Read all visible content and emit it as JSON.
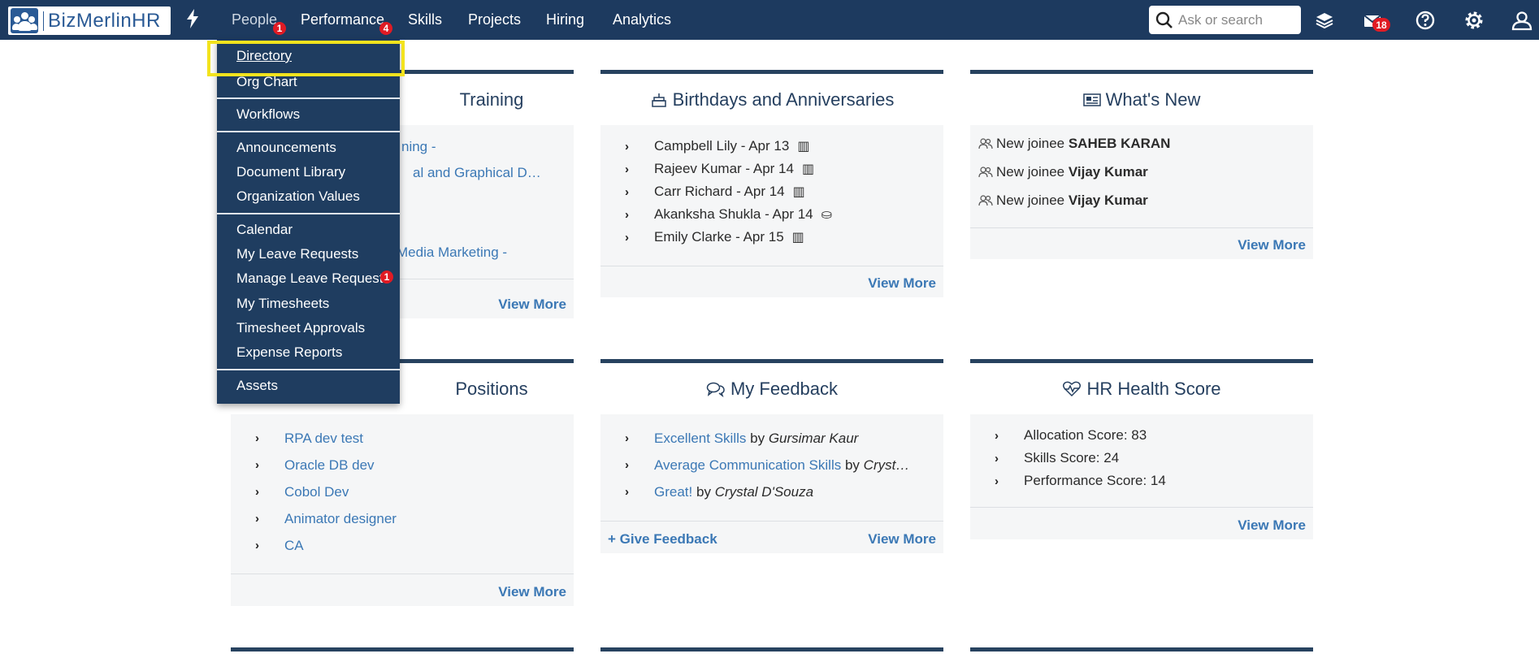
{
  "brand": {
    "name": "BizMerlinHR"
  },
  "nav": {
    "items": [
      {
        "label": "People",
        "badge": "1"
      },
      {
        "label": "Performance",
        "badge": "4"
      },
      {
        "label": "Skills"
      },
      {
        "label": "Projects"
      },
      {
        "label": "Hiring"
      },
      {
        "label": "Analytics"
      }
    ],
    "search_placeholder": "Ask or search",
    "inbox_badge": "18"
  },
  "dropdown": {
    "items": [
      "Directory",
      "Org Chart",
      "Workflows",
      "Announcements",
      "Document Library",
      "Organization Values",
      "Calendar",
      "My Leave Requests",
      "Manage Leave Requests",
      "My Timesheets",
      "Timesheet Approvals",
      "Expense Reports",
      "Assets"
    ],
    "manage_leave_badge": "1"
  },
  "training": {
    "title": "Training",
    "line1": "ning -",
    "line2": "al and Graphical D…",
    "line3": "Media Marketing",
    "line3_suffix": " -",
    "view_more": "View More"
  },
  "birthdays": {
    "title": "Birthdays and Anniversaries",
    "items": [
      "Campbell Lily - Apr 13",
      "Rajeev Kumar - Apr 14",
      "Carr Richard - Apr 14",
      "Akanksha Shukla - Apr 14",
      "Emily Clarke - Apr 15"
    ],
    "view_more": "View More"
  },
  "whats_new": {
    "title": "What's New",
    "prefix": "New joinee",
    "items": [
      "SAHEB KARAN",
      "Vijay Kumar",
      "Vijay Kumar"
    ],
    "view_more": "View More"
  },
  "positions": {
    "title": "Positions",
    "items": [
      "RPA dev test",
      "Oracle DB dev",
      "Cobol Dev",
      "Animator designer",
      "CA"
    ],
    "view_more": "View More"
  },
  "feedback": {
    "title": "My Feedback",
    "by": "by",
    "items": [
      {
        "text": "Excellent Skills",
        "author": "Gursimar Kaur"
      },
      {
        "text": "Average Communication Skills",
        "author": "Cryst…"
      },
      {
        "text": "Great!",
        "author": "Crystal D'Souza"
      }
    ],
    "give_feedback": "+ Give Feedback",
    "view_more": "View More"
  },
  "hr_health": {
    "title": "HR Health Score",
    "items": [
      "Allocation Score: 83",
      "Skills Score: 24",
      "Performance Score: 14"
    ],
    "view_more": "View More"
  }
}
